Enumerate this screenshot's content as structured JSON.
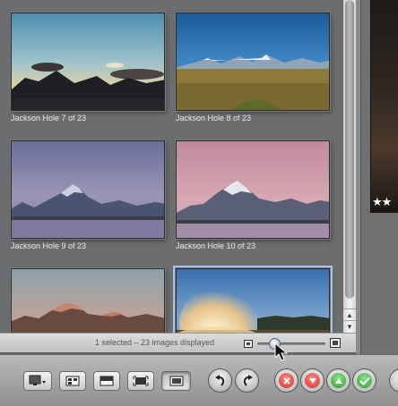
{
  "browser": {
    "thumbnails": [
      {
        "caption": "Jackson Hole 7 of 23",
        "scene": "sunset-mountains",
        "selected": false
      },
      {
        "caption": "Jackson Hole 8 of 23",
        "scene": "blue-sky-plains",
        "selected": false
      },
      {
        "caption": "Jackson Hole 9 of 23",
        "scene": "dusk-mountain-blue",
        "selected": false
      },
      {
        "caption": "Jackson Hole 10 of 23",
        "scene": "dusk-mountain-pink",
        "selected": false
      },
      {
        "caption": "",
        "scene": "alpenglow-peaks",
        "selected": false
      },
      {
        "caption": "",
        "scene": "geyser-steam",
        "selected": true
      }
    ]
  },
  "status": {
    "text": "1 selected – 23 images displayed",
    "thumbnail_size_level": 0.2
  },
  "viewer": {
    "rating_stars": "★★"
  },
  "toolbar": {
    "view_buttons": [
      "monitor-menu-icon",
      "browser-icon",
      "filmstrip-icon",
      "fit-icon",
      "single-view-icon"
    ],
    "rotate_buttons": [
      "rotate-left-icon",
      "rotate-right-icon"
    ],
    "rating_buttons": [
      {
        "name": "reject-button",
        "color": "#e8423c",
        "icon": "x-icon"
      },
      {
        "name": "decrease-rating-button",
        "color": "#e64a45",
        "icon": "down-arrow-icon"
      },
      {
        "name": "increase-rating-button",
        "color": "#49b54a",
        "icon": "up-arrow-icon"
      },
      {
        "name": "select-button",
        "color": "#4cb84c",
        "icon": "check-icon"
      }
    ]
  }
}
